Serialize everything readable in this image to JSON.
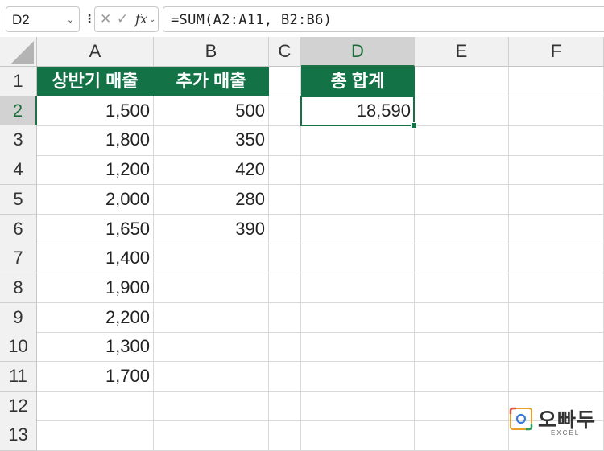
{
  "formula_bar": {
    "name_box": "D2",
    "formula": "=SUM(A2:A11, B2:B6)"
  },
  "icons": {
    "cancel": "✕",
    "enter": "✓",
    "fx": "fx",
    "chevron": "⌄",
    "more": "⋮"
  },
  "columns": [
    "A",
    "B",
    "C",
    "D",
    "E",
    "F"
  ],
  "rows": [
    "1",
    "2",
    "3",
    "4",
    "5",
    "6",
    "7",
    "8",
    "9",
    "10",
    "11",
    "12",
    "13"
  ],
  "cells": {
    "A1": "상반기 매출",
    "B1": "추가 매출",
    "D1": "총 합계",
    "A2": "1,500",
    "B2": "500",
    "D2": "18,590",
    "A3": "1,800",
    "B3": "350",
    "A4": "1,200",
    "B4": "420",
    "A5": "2,000",
    "B5": "280",
    "A6": "1,650",
    "B6": "390",
    "A7": "1,400",
    "A8": "1,900",
    "A9": "2,200",
    "A10": "1,300",
    "A11": "1,700"
  },
  "selected_cell": "D2",
  "logo": {
    "brand": "오빠두",
    "sub": "EXCEL"
  },
  "colors": {
    "header_green": "#137347",
    "selection": "#137347"
  }
}
